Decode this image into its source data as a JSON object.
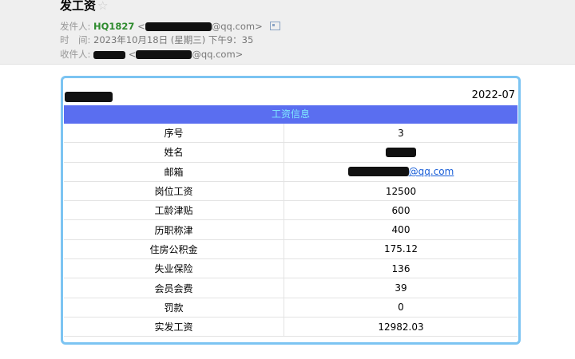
{
  "email": {
    "subject": "发工资",
    "star_icon": "☆",
    "from_label": "发件人:",
    "from_name": "HQ1827",
    "from_prefix": "<",
    "from_suffix": "@qq.com>",
    "time_label": "时　间:",
    "time_value": "2023年10月18日 (星期三) 下午9：35",
    "to_label": "收件人:",
    "to_prefix": "<",
    "to_suffix": "@qq.com>"
  },
  "payslip": {
    "period": "2022-07",
    "header": "工资信息",
    "rows": [
      {
        "label": "序号",
        "value": "3"
      },
      {
        "label": "姓名",
        "value": ""
      },
      {
        "label": "邮箱",
        "value": "@qq.com"
      },
      {
        "label": "岗位工资",
        "value": "12500"
      },
      {
        "label": "工龄津贴",
        "value": "600"
      },
      {
        "label": "历职称津",
        "value": "400"
      },
      {
        "label": "住房公积金",
        "value": "175.12"
      },
      {
        "label": "失业保险",
        "value": "136"
      },
      {
        "label": "会员会费",
        "value": "39"
      },
      {
        "label": "罚款",
        "value": "0"
      },
      {
        "label": "实发工资",
        "value": "12982.03"
      }
    ]
  }
}
